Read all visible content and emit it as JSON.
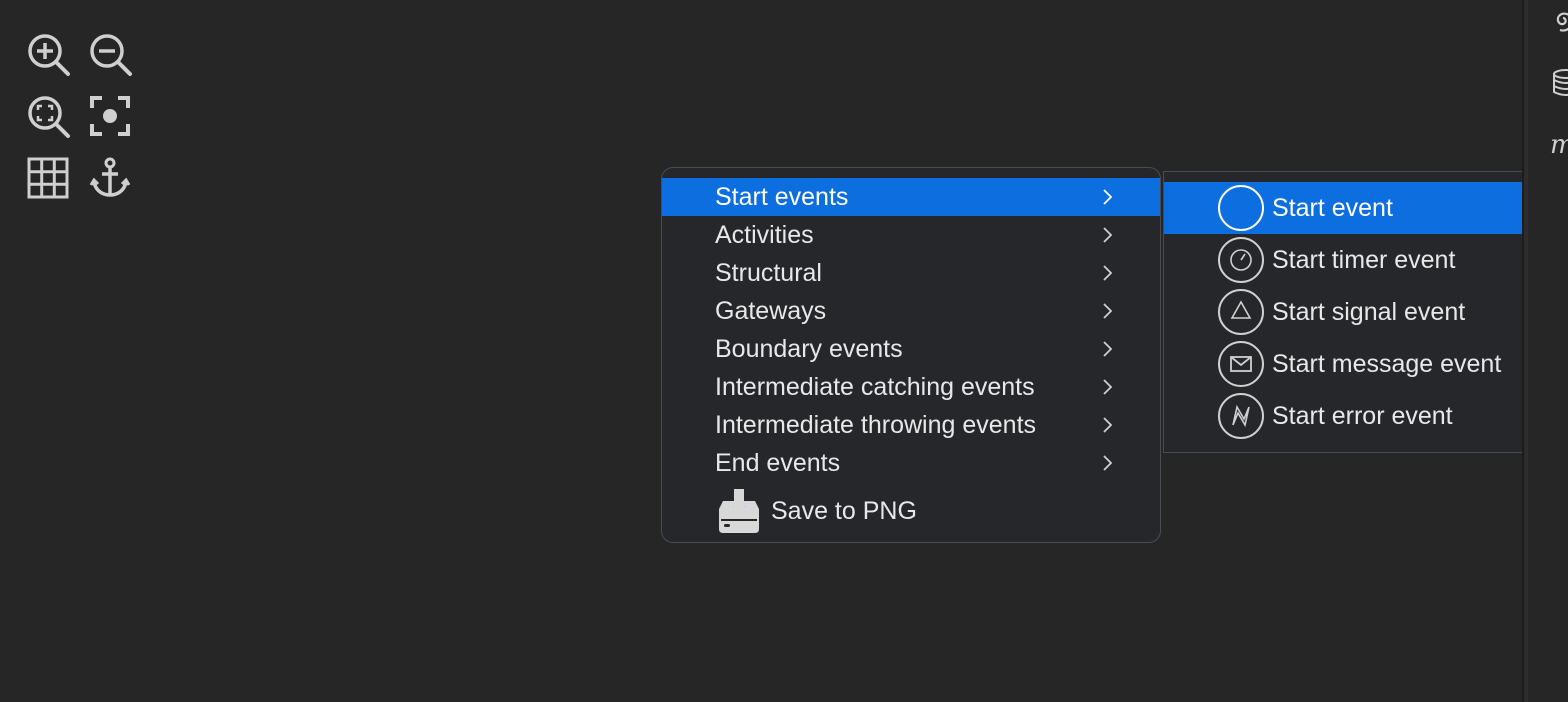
{
  "toolbar": {
    "tools": [
      {
        "name": "zoom-in-icon"
      },
      {
        "name": "zoom-out-icon"
      },
      {
        "name": "zoom-fit-icon"
      },
      {
        "name": "center-focus-icon"
      },
      {
        "name": "grid-icon"
      },
      {
        "name": "anchor-icon"
      }
    ]
  },
  "side_panel": {
    "icons": [
      "swirl-icon",
      "database-icon",
      "italic-m-icon"
    ],
    "visible_glyph": "m"
  },
  "context_menu": {
    "items": [
      {
        "label": "Start events",
        "active": true
      },
      {
        "label": "Activities"
      },
      {
        "label": "Structural"
      },
      {
        "label": "Gateways"
      },
      {
        "label": "Boundary events"
      },
      {
        "label": "Intermediate catching events"
      },
      {
        "label": "Intermediate throwing events"
      },
      {
        "label": "End events"
      }
    ],
    "save_label": "Save to PNG"
  },
  "submenu": {
    "items": [
      {
        "label": "Start event",
        "icon": "start-event-icon",
        "active": true
      },
      {
        "label": "Start timer event",
        "icon": "timer-event-icon"
      },
      {
        "label": "Start signal event",
        "icon": "signal-event-icon"
      },
      {
        "label": "Start message event",
        "icon": "message-event-icon"
      },
      {
        "label": "Start error event",
        "icon": "error-event-icon"
      }
    ]
  },
  "colors": {
    "background": "#262626",
    "menu_bg": "#25272a",
    "highlight": "#0d6ee0",
    "icon": "#cfcfcf"
  }
}
